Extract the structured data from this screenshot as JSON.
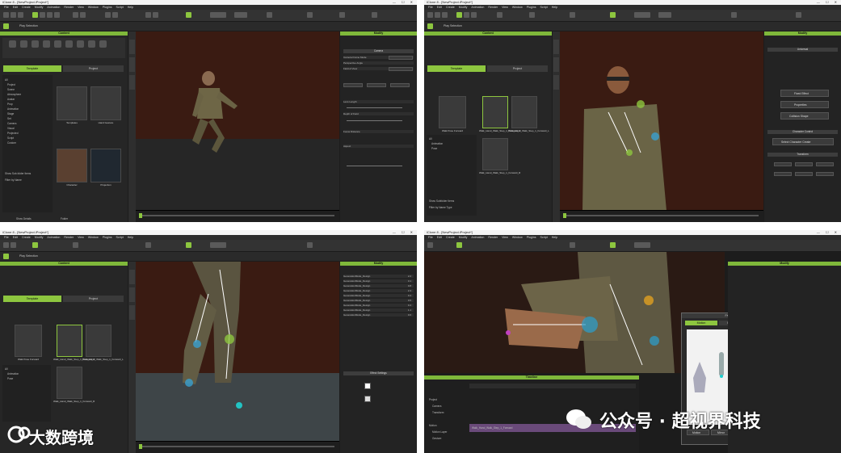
{
  "windows": [
    {
      "title": "iClone 8 - [NewProject.iProject*]"
    },
    {
      "title": "iClone 8 - [NewProject.iProject*]"
    },
    {
      "title": "iClone 8 - [NewProject.iProject*]"
    },
    {
      "title": "iClone 8 - [NewProject.iProject*]"
    }
  ],
  "menu": [
    "File",
    "Edit",
    "Create",
    "Modify",
    "Animation",
    "Render",
    "View",
    "Window",
    "Plugins",
    "Script",
    "Help"
  ],
  "window_controls": "— ☐ ✕",
  "subbar_label": "Play Selection",
  "content_panel": {
    "header": "Content",
    "tab_template": "Template",
    "tab_project": "Project",
    "tree_w1": [
      "All",
      "Project",
      "Scene",
      "Atmosphere",
      "Avatar",
      "Prop",
      "Animation",
      "Stage",
      "Set",
      "Camera",
      "Visual",
      "Projected",
      "Script",
      "Custom"
    ],
    "tree_w1_footer": [
      "Show Sub-folder Items",
      "Filter by Name"
    ],
    "tree_w2": [
      "All",
      "Animation",
      "Pose"
    ],
    "tree_w2_footer": [
      "Show Subfolder Items",
      "Filter by Name Type"
    ],
    "thumbs_w1": [
      "Templates",
      "Hand Gesture",
      "Character",
      "Projection"
    ],
    "thumbs_w2": [
      "Walk Pose Forward",
      "Walk_Hand_Walk_Step_1_Forward_C",
      "Walk_Hand_Walk_Step_1_Forward_L",
      "Walk_Hand_Walk_Step_1_Forward_R"
    ],
    "footer": [
      "Show Details",
      "Folder"
    ]
  },
  "modify_panel": {
    "header": "Modify",
    "w1_section": "Camera",
    "w1_rows": [
      "Camera Frame Mode",
      "Perspective Angle",
      "Field of View",
      "Lens Length",
      "Depth of Field",
      "Focus Distance",
      "Aspect"
    ],
    "w1_values": [
      "Perspective",
      "Unlimited",
      "45.00"
    ],
    "w2_sections": [
      "Universal",
      "Character Control",
      "Transform"
    ],
    "w2_buttons": [
      "Fixed Effect",
      "Properties",
      "Collision Shape",
      "Select Character Create"
    ],
    "w3_section": "Effect Settings",
    "w3_list": [
      "GenerationMode_Design",
      "GenerationMode_Design",
      "GenerationMode_Design",
      "GenerationMode_Design",
      "GenerationMode_Design",
      "GenerationMode_Design",
      "GenerationMode_Design",
      "GenerationMode_Design",
      "GenerationMode_Design"
    ],
    "w3_values": [
      "2.2",
      "3.1",
      "0.8",
      "2.4",
      "0.4",
      "0.5",
      "0.4",
      "1.1",
      "0.6"
    ]
  },
  "timeline": {
    "header": "Timeline",
    "tracks": [
      "Project",
      "Camera",
      "Transform",
      "Motion",
      "Motion Layer",
      "Gesture"
    ],
    "clip": "Walk_Hand_Walk_Step_1_Forward"
  },
  "fk_dialog": {
    "title": "FK Motion Layer",
    "tabs": [
      "Motion",
      "FK / IK Lock",
      "Pin to Pose"
    ],
    "buttons": [
      "Motion",
      "Mirror",
      "Copy Pose",
      "Paste Pose"
    ]
  },
  "watermarks": {
    "left": "大数跨境",
    "right": "公众号 · 超视界科技"
  },
  "colors": {
    "accent": "#8dc63f",
    "viewport_bg": "#3a1b12",
    "panel_bg": "#262626"
  }
}
